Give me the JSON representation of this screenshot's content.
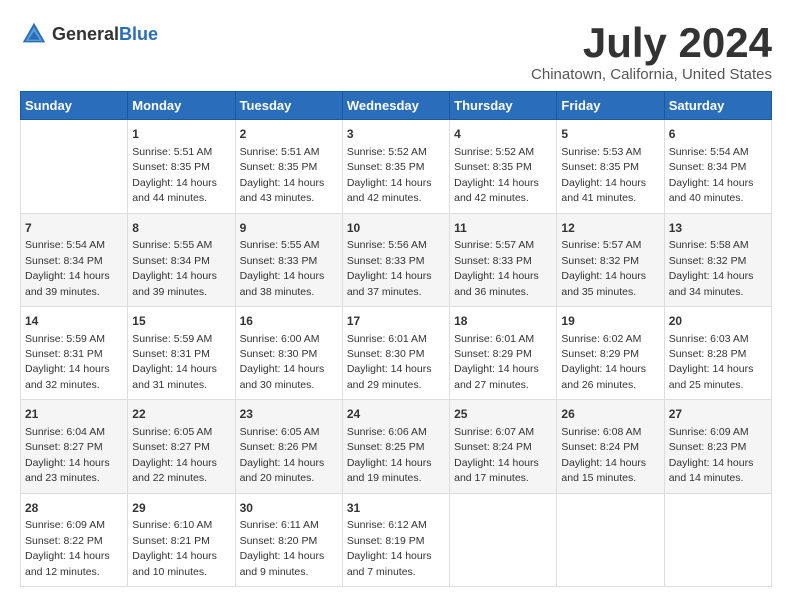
{
  "header": {
    "logo_general": "General",
    "logo_blue": "Blue",
    "title": "July 2024",
    "subtitle": "Chinatown, California, United States"
  },
  "calendar": {
    "days": [
      "Sunday",
      "Monday",
      "Tuesday",
      "Wednesday",
      "Thursday",
      "Friday",
      "Saturday"
    ],
    "weeks": [
      [
        {
          "day": "",
          "content": ""
        },
        {
          "day": "1",
          "content": "Sunrise: 5:51 AM\nSunset: 8:35 PM\nDaylight: 14 hours\nand 44 minutes."
        },
        {
          "day": "2",
          "content": "Sunrise: 5:51 AM\nSunset: 8:35 PM\nDaylight: 14 hours\nand 43 minutes."
        },
        {
          "day": "3",
          "content": "Sunrise: 5:52 AM\nSunset: 8:35 PM\nDaylight: 14 hours\nand 42 minutes."
        },
        {
          "day": "4",
          "content": "Sunrise: 5:52 AM\nSunset: 8:35 PM\nDaylight: 14 hours\nand 42 minutes."
        },
        {
          "day": "5",
          "content": "Sunrise: 5:53 AM\nSunset: 8:35 PM\nDaylight: 14 hours\nand 41 minutes."
        },
        {
          "day": "6",
          "content": "Sunrise: 5:54 AM\nSunset: 8:34 PM\nDaylight: 14 hours\nand 40 minutes."
        }
      ],
      [
        {
          "day": "7",
          "content": "Sunrise: 5:54 AM\nSunset: 8:34 PM\nDaylight: 14 hours\nand 39 minutes."
        },
        {
          "day": "8",
          "content": "Sunrise: 5:55 AM\nSunset: 8:34 PM\nDaylight: 14 hours\nand 39 minutes."
        },
        {
          "day": "9",
          "content": "Sunrise: 5:55 AM\nSunset: 8:33 PM\nDaylight: 14 hours\nand 38 minutes."
        },
        {
          "day": "10",
          "content": "Sunrise: 5:56 AM\nSunset: 8:33 PM\nDaylight: 14 hours\nand 37 minutes."
        },
        {
          "day": "11",
          "content": "Sunrise: 5:57 AM\nSunset: 8:33 PM\nDaylight: 14 hours\nand 36 minutes."
        },
        {
          "day": "12",
          "content": "Sunrise: 5:57 AM\nSunset: 8:32 PM\nDaylight: 14 hours\nand 35 minutes."
        },
        {
          "day": "13",
          "content": "Sunrise: 5:58 AM\nSunset: 8:32 PM\nDaylight: 14 hours\nand 34 minutes."
        }
      ],
      [
        {
          "day": "14",
          "content": "Sunrise: 5:59 AM\nSunset: 8:31 PM\nDaylight: 14 hours\nand 32 minutes."
        },
        {
          "day": "15",
          "content": "Sunrise: 5:59 AM\nSunset: 8:31 PM\nDaylight: 14 hours\nand 31 minutes."
        },
        {
          "day": "16",
          "content": "Sunrise: 6:00 AM\nSunset: 8:30 PM\nDaylight: 14 hours\nand 30 minutes."
        },
        {
          "day": "17",
          "content": "Sunrise: 6:01 AM\nSunset: 8:30 PM\nDaylight: 14 hours\nand 29 minutes."
        },
        {
          "day": "18",
          "content": "Sunrise: 6:01 AM\nSunset: 8:29 PM\nDaylight: 14 hours\nand 27 minutes."
        },
        {
          "day": "19",
          "content": "Sunrise: 6:02 AM\nSunset: 8:29 PM\nDaylight: 14 hours\nand 26 minutes."
        },
        {
          "day": "20",
          "content": "Sunrise: 6:03 AM\nSunset: 8:28 PM\nDaylight: 14 hours\nand 25 minutes."
        }
      ],
      [
        {
          "day": "21",
          "content": "Sunrise: 6:04 AM\nSunset: 8:27 PM\nDaylight: 14 hours\nand 23 minutes."
        },
        {
          "day": "22",
          "content": "Sunrise: 6:05 AM\nSunset: 8:27 PM\nDaylight: 14 hours\nand 22 minutes."
        },
        {
          "day": "23",
          "content": "Sunrise: 6:05 AM\nSunset: 8:26 PM\nDaylight: 14 hours\nand 20 minutes."
        },
        {
          "day": "24",
          "content": "Sunrise: 6:06 AM\nSunset: 8:25 PM\nDaylight: 14 hours\nand 19 minutes."
        },
        {
          "day": "25",
          "content": "Sunrise: 6:07 AM\nSunset: 8:24 PM\nDaylight: 14 hours\nand 17 minutes."
        },
        {
          "day": "26",
          "content": "Sunrise: 6:08 AM\nSunset: 8:24 PM\nDaylight: 14 hours\nand 15 minutes."
        },
        {
          "day": "27",
          "content": "Sunrise: 6:09 AM\nSunset: 8:23 PM\nDaylight: 14 hours\nand 14 minutes."
        }
      ],
      [
        {
          "day": "28",
          "content": "Sunrise: 6:09 AM\nSunset: 8:22 PM\nDaylight: 14 hours\nand 12 minutes."
        },
        {
          "day": "29",
          "content": "Sunrise: 6:10 AM\nSunset: 8:21 PM\nDaylight: 14 hours\nand 10 minutes."
        },
        {
          "day": "30",
          "content": "Sunrise: 6:11 AM\nSunset: 8:20 PM\nDaylight: 14 hours\nand 9 minutes."
        },
        {
          "day": "31",
          "content": "Sunrise: 6:12 AM\nSunset: 8:19 PM\nDaylight: 14 hours\nand 7 minutes."
        },
        {
          "day": "",
          "content": ""
        },
        {
          "day": "",
          "content": ""
        },
        {
          "day": "",
          "content": ""
        }
      ]
    ]
  }
}
